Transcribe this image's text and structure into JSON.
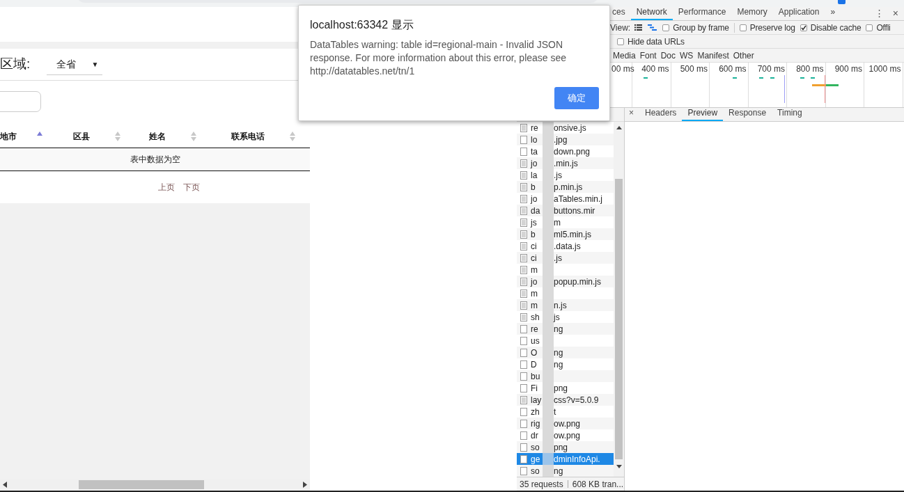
{
  "page": {
    "region_label": "区域:",
    "region_select": {
      "value": "全省",
      "arrow": "▼"
    },
    "table": {
      "columns": [
        {
          "label": "地市",
          "sorted": true
        },
        {
          "label": "区县",
          "sorted": false
        },
        {
          "label": "姓名",
          "sorted": false
        },
        {
          "label": "联系电话",
          "sorted": false
        }
      ],
      "empty_message": "表中数据为空"
    },
    "pagination": [
      "上页",
      "下页"
    ]
  },
  "dialog": {
    "title": "localhost:63342 显示",
    "message": "DataTables warning: table id=regional-main - Invalid JSON response. For more information about this error, please see http://datatables.net/tn/1",
    "button": "确定"
  },
  "devtools": {
    "tabs": [
      {
        "label": "ces",
        "selected": false
      },
      {
        "label": "Network",
        "selected": true
      },
      {
        "label": "Performance",
        "selected": false
      },
      {
        "label": "Memory",
        "selected": false
      },
      {
        "label": "Application",
        "selected": false
      }
    ],
    "more": "»",
    "menu": "⋮",
    "close": "×",
    "view_label": "View:",
    "options": [
      {
        "label": "Group by frame",
        "checked": false
      },
      {
        "label": "Preserve log",
        "checked": false
      },
      {
        "label": "Disable cache",
        "checked": true
      },
      {
        "label": "Offli",
        "checked": false
      }
    ],
    "hide_data_urls": {
      "label": "Hide data URLs",
      "checked": false
    },
    "filters": [
      "Media",
      "Font",
      "Doc",
      "WS",
      "Manifest",
      "Other"
    ],
    "timeline_ticks": [
      "00 ms",
      "400 ms",
      "500 ms",
      "600 ms",
      "700 ms",
      "800 ms",
      "900 ms",
      "1000 ms"
    ],
    "requests": [
      {
        "start": "re",
        "end": "onsive.js",
        "kind": "script",
        "selected": false
      },
      {
        "start": "lo",
        "end": ".jpg",
        "kind": "file",
        "selected": false
      },
      {
        "start": "ta",
        "end": "down.png",
        "kind": "file",
        "selected": false
      },
      {
        "start": "jo",
        "end": ".min.js",
        "kind": "script",
        "selected": false
      },
      {
        "start": "la",
        "end": ".js",
        "kind": "script",
        "selected": false
      },
      {
        "start": "b",
        "end": "p.min.js",
        "kind": "script",
        "selected": false
      },
      {
        "start": "jo",
        "end": "aTables.min.j",
        "kind": "script",
        "selected": false
      },
      {
        "start": "da",
        "end": "buttons.mir",
        "kind": "script",
        "selected": false
      },
      {
        "start": "js",
        "end": "m",
        "kind": "script",
        "selected": false
      },
      {
        "start": "b",
        "end": "ml5.min.js",
        "kind": "script",
        "selected": false
      },
      {
        "start": "ci",
        "end": ".data.js",
        "kind": "script",
        "selected": false
      },
      {
        "start": "ci",
        "end": ".js",
        "kind": "script",
        "selected": false
      },
      {
        "start": "m",
        "kind": "script",
        "selected": false
      },
      {
        "start": "jo",
        "end": "popup.min.js",
        "kind": "script",
        "selected": false
      },
      {
        "start": "m",
        "kind": "script",
        "selected": false
      },
      {
        "start": "m",
        "end": "n.js",
        "kind": "script",
        "selected": false
      },
      {
        "start": "sh",
        "end": "js",
        "kind": "script",
        "selected": false
      },
      {
        "start": "re",
        "end": "ng",
        "kind": "file",
        "selected": false
      },
      {
        "start": "us",
        "kind": "file",
        "selected": false
      },
      {
        "start": "O",
        "end": "ng",
        "kind": "file",
        "selected": false
      },
      {
        "start": "D",
        "end": "ng",
        "kind": "file",
        "selected": false
      },
      {
        "start": "bu",
        "kind": "file",
        "selected": false
      },
      {
        "start": "Fi",
        "end": "png",
        "kind": "file",
        "selected": false
      },
      {
        "start": "lay",
        "end": "css?v=5.0.9",
        "kind": "script",
        "selected": false
      },
      {
        "start": "zh",
        "end": "t",
        "kind": "file",
        "selected": false
      },
      {
        "start": "rig",
        "end": "ow.png",
        "kind": "file",
        "selected": false
      },
      {
        "start": "dr",
        "end": "ow.png",
        "kind": "file",
        "selected": false
      },
      {
        "start": "so",
        "end": "png",
        "kind": "file",
        "selected": false
      },
      {
        "start": "ge",
        "end": "dminInfoApi.",
        "kind": "file",
        "selected": true
      },
      {
        "start": "so",
        "end": "ng",
        "kind": "file",
        "selected": false
      }
    ],
    "detail_close": "×",
    "detail_tabs": [
      {
        "label": "Headers",
        "selected": false
      },
      {
        "label": "Preview",
        "selected": true
      },
      {
        "label": "Response",
        "selected": false
      },
      {
        "label": "Timing",
        "selected": false
      }
    ],
    "status": {
      "requests": "35 requests",
      "transferred": "608 KB tran..."
    }
  }
}
